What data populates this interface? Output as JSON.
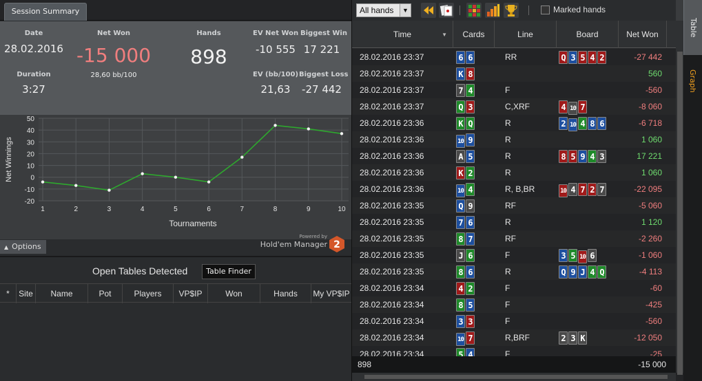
{
  "left": {
    "tab_label": "Session Summary",
    "summary": {
      "date_label": "Date",
      "date": "28.02.2016",
      "netwon_label": "Net Won",
      "netwon": "-15 000",
      "bb100": "28,60 bb/100",
      "hands_label": "Hands",
      "hands": "898",
      "evnet_label": "EV Net Won",
      "evnet": "-10 555",
      "bigwin_label": "Biggest Win",
      "bigwin": "17 221",
      "duration_label": "Duration",
      "duration": "3:27",
      "evbb_label": "EV (bb/100)",
      "evbb": "21,63",
      "bigloss_label": "Biggest Loss",
      "bigloss": "-27 442"
    },
    "options_label": "Options",
    "powered_by": "Powered by",
    "hm_name": "Hold'em Manager",
    "open_tables_title": "Open Tables Detected",
    "table_finder_label": "Table Finder",
    "ot_columns": [
      "*",
      "Site",
      "Name",
      "Pot",
      "Players",
      "VP$IP",
      "Won",
      "Hands",
      "My VP$IP"
    ]
  },
  "chart_data": {
    "type": "line",
    "x": [
      1,
      2,
      3,
      4,
      5,
      6,
      7,
      8,
      9,
      10
    ],
    "series": [
      {
        "values": [
          -4,
          -7,
          -11,
          3,
          0,
          -4,
          17,
          44,
          41,
          37
        ]
      }
    ],
    "xlabel": "Tournaments",
    "ylabel": "Net Winnings",
    "xlim": [
      1,
      10
    ],
    "ylim": [
      -20,
      50
    ],
    "yticks": [
      -20,
      -10,
      0,
      10,
      20,
      30,
      40,
      50
    ],
    "grid": true,
    "line_color": "#2ea82e"
  },
  "right": {
    "filter_value": "All hands",
    "marked_label": "Marked hands",
    "columns": {
      "time": "Time",
      "cards": "Cards",
      "line": "Line",
      "board": "Board",
      "netwon": "Net Won"
    },
    "rows": [
      {
        "time": "28.02.2016 23:37",
        "cards": [
          [
            "6",
            "d"
          ],
          [
            "6",
            "d"
          ]
        ],
        "line": "RR",
        "board": [
          [
            "Q",
            "h"
          ],
          [
            "3",
            "d"
          ],
          [
            "5",
            "h"
          ],
          [
            "4",
            "h"
          ],
          [
            "2",
            "h"
          ]
        ],
        "won": "-27 442",
        "pos": false
      },
      {
        "time": "28.02.2016 23:37",
        "cards": [
          [
            "K",
            "d"
          ],
          [
            "8",
            "h"
          ]
        ],
        "line": "",
        "board": [],
        "won": "560",
        "pos": true
      },
      {
        "time": "28.02.2016 23:37",
        "cards": [
          [
            "7",
            "s"
          ],
          [
            "4",
            "c"
          ]
        ],
        "line": "F",
        "board": [],
        "won": "-560",
        "pos": false
      },
      {
        "time": "28.02.2016 23:37",
        "cards": [
          [
            "Q",
            "c"
          ],
          [
            "3",
            "h"
          ]
        ],
        "line": "C,XRF",
        "board": [
          [
            "4",
            "h"
          ],
          [
            "10",
            "s"
          ],
          [
            "7",
            "h"
          ]
        ],
        "won": "-8 060",
        "pos": false
      },
      {
        "time": "28.02.2016 23:36",
        "cards": [
          [
            "K",
            "c"
          ],
          [
            "Q",
            "c"
          ]
        ],
        "line": "R",
        "board": [
          [
            "2",
            "d"
          ],
          [
            "10",
            "d"
          ],
          [
            "4",
            "c"
          ],
          [
            "8",
            "d"
          ],
          [
            "6",
            "d"
          ]
        ],
        "won": "-6 718",
        "pos": false
      },
      {
        "time": "28.02.2016 23:36",
        "cards": [
          [
            "10",
            "d"
          ],
          [
            "9",
            "d"
          ]
        ],
        "line": "R",
        "board": [],
        "won": "1 060",
        "pos": true
      },
      {
        "time": "28.02.2016 23:36",
        "cards": [
          [
            "A",
            "s"
          ],
          [
            "5",
            "d"
          ]
        ],
        "line": "R",
        "board": [
          [
            "8",
            "h"
          ],
          [
            "5",
            "h"
          ],
          [
            "9",
            "d"
          ],
          [
            "4",
            "c"
          ],
          [
            "3",
            "s"
          ]
        ],
        "won": "17 221",
        "pos": true
      },
      {
        "time": "28.02.2016 23:36",
        "cards": [
          [
            "K",
            "h"
          ],
          [
            "2",
            "c"
          ]
        ],
        "line": "R",
        "board": [],
        "won": "1 060",
        "pos": true
      },
      {
        "time": "28.02.2016 23:36",
        "cards": [
          [
            "10",
            "d"
          ],
          [
            "4",
            "c"
          ]
        ],
        "line": "R, B,BR",
        "board": [
          [
            "10",
            "h"
          ],
          [
            "4",
            "s"
          ],
          [
            "7",
            "h"
          ],
          [
            "2",
            "h"
          ],
          [
            "7",
            "s"
          ]
        ],
        "won": "-22 095",
        "pos": false
      },
      {
        "time": "28.02.2016 23:35",
        "cards": [
          [
            "Q",
            "d"
          ],
          [
            "9",
            "s"
          ]
        ],
        "line": "RF",
        "board": [],
        "won": "-5 060",
        "pos": false
      },
      {
        "time": "28.02.2016 23:35",
        "cards": [
          [
            "7",
            "d"
          ],
          [
            "6",
            "d"
          ]
        ],
        "line": "R",
        "board": [],
        "won": "1 120",
        "pos": true
      },
      {
        "time": "28.02.2016 23:35",
        "cards": [
          [
            "8",
            "c"
          ],
          [
            "7",
            "d"
          ]
        ],
        "line": "RF",
        "board": [],
        "won": "-2 260",
        "pos": false
      },
      {
        "time": "28.02.2016 23:35",
        "cards": [
          [
            "J",
            "s"
          ],
          [
            "6",
            "c"
          ]
        ],
        "line": "F",
        "board": [
          [
            "3",
            "d"
          ],
          [
            "5",
            "c"
          ],
          [
            "10",
            "h"
          ],
          [
            "6",
            "s"
          ]
        ],
        "won": "-1 060",
        "pos": false
      },
      {
        "time": "28.02.2016 23:35",
        "cards": [
          [
            "8",
            "c"
          ],
          [
            "6",
            "d"
          ]
        ],
        "line": "R",
        "board": [
          [
            "Q",
            "d"
          ],
          [
            "9",
            "d"
          ],
          [
            "J",
            "d"
          ],
          [
            "4",
            "c"
          ],
          [
            "Q",
            "c"
          ]
        ],
        "won": "-4 113",
        "pos": false
      },
      {
        "time": "28.02.2016 23:34",
        "cards": [
          [
            "4",
            "h"
          ],
          [
            "2",
            "c"
          ]
        ],
        "line": "F",
        "board": [],
        "won": "-60",
        "pos": false
      },
      {
        "time": "28.02.2016 23:34",
        "cards": [
          [
            "8",
            "c"
          ],
          [
            "5",
            "d"
          ]
        ],
        "line": "F",
        "board": [],
        "won": "-425",
        "pos": false
      },
      {
        "time": "28.02.2016 23:34",
        "cards": [
          [
            "3",
            "d"
          ],
          [
            "3",
            "h"
          ]
        ],
        "line": "F",
        "board": [],
        "won": "-560",
        "pos": false
      },
      {
        "time": "28.02.2016 23:34",
        "cards": [
          [
            "10",
            "d"
          ],
          [
            "7",
            "h"
          ]
        ],
        "line": "R,BRF",
        "board": [
          [
            "2",
            "s"
          ],
          [
            "3",
            "s"
          ],
          [
            "K",
            "s"
          ]
        ],
        "won": "-12 050",
        "pos": false
      },
      {
        "time": "28.02.2016 23:34",
        "cards": [
          [
            "5",
            "c"
          ],
          [
            "4",
            "d"
          ]
        ],
        "line": "F",
        "board": [],
        "won": "-25",
        "pos": false
      }
    ],
    "footer_hands": "898",
    "footer_total": "-15 000"
  },
  "side": {
    "table_label": "Table",
    "graph_label": "Graph"
  },
  "colors": {
    "neg": "#f07e7e",
    "pos": "#6fdc6f",
    "accent": "#f0a020"
  }
}
